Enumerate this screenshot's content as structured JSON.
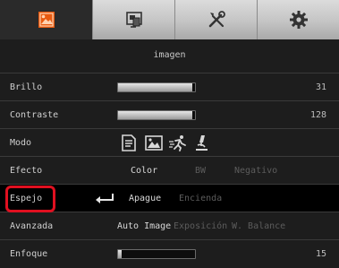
{
  "tabs": [
    {
      "icon": "image-settings-icon",
      "active": true
    },
    {
      "icon": "display-settings-icon",
      "active": false
    },
    {
      "icon": "tools-icon",
      "active": false
    },
    {
      "icon": "gear-icon",
      "active": false
    }
  ],
  "subtitle": "imagen",
  "rows": {
    "brillo": {
      "label": "Brillo",
      "value": "31",
      "level": 0.97
    },
    "contraste": {
      "label": "Contraste",
      "value": "128",
      "level": 0.97
    },
    "modo": {
      "label": "Modo",
      "icons": [
        "document-icon",
        "photo-icon",
        "motion-icon",
        "microscope-icon"
      ]
    },
    "efecto": {
      "label": "Efecto",
      "options": [
        "Color",
        "BW",
        "Negativo"
      ],
      "selected": "Color"
    },
    "espejo": {
      "label": "Espejo",
      "options": [
        "Apague",
        "Encienda"
      ],
      "selected": "Apague"
    },
    "avanzada": {
      "label": "Avanzada",
      "options": [
        "Auto Image",
        "Exposición",
        "W. Balance"
      ],
      "selected": "Auto Image"
    },
    "enfoque": {
      "label": "Enfoque",
      "value": "15",
      "level": 0.05
    }
  },
  "colors": {
    "accent_orange": "#e85a10",
    "selection_red": "#e01020",
    "background": "#1d1d1d"
  }
}
